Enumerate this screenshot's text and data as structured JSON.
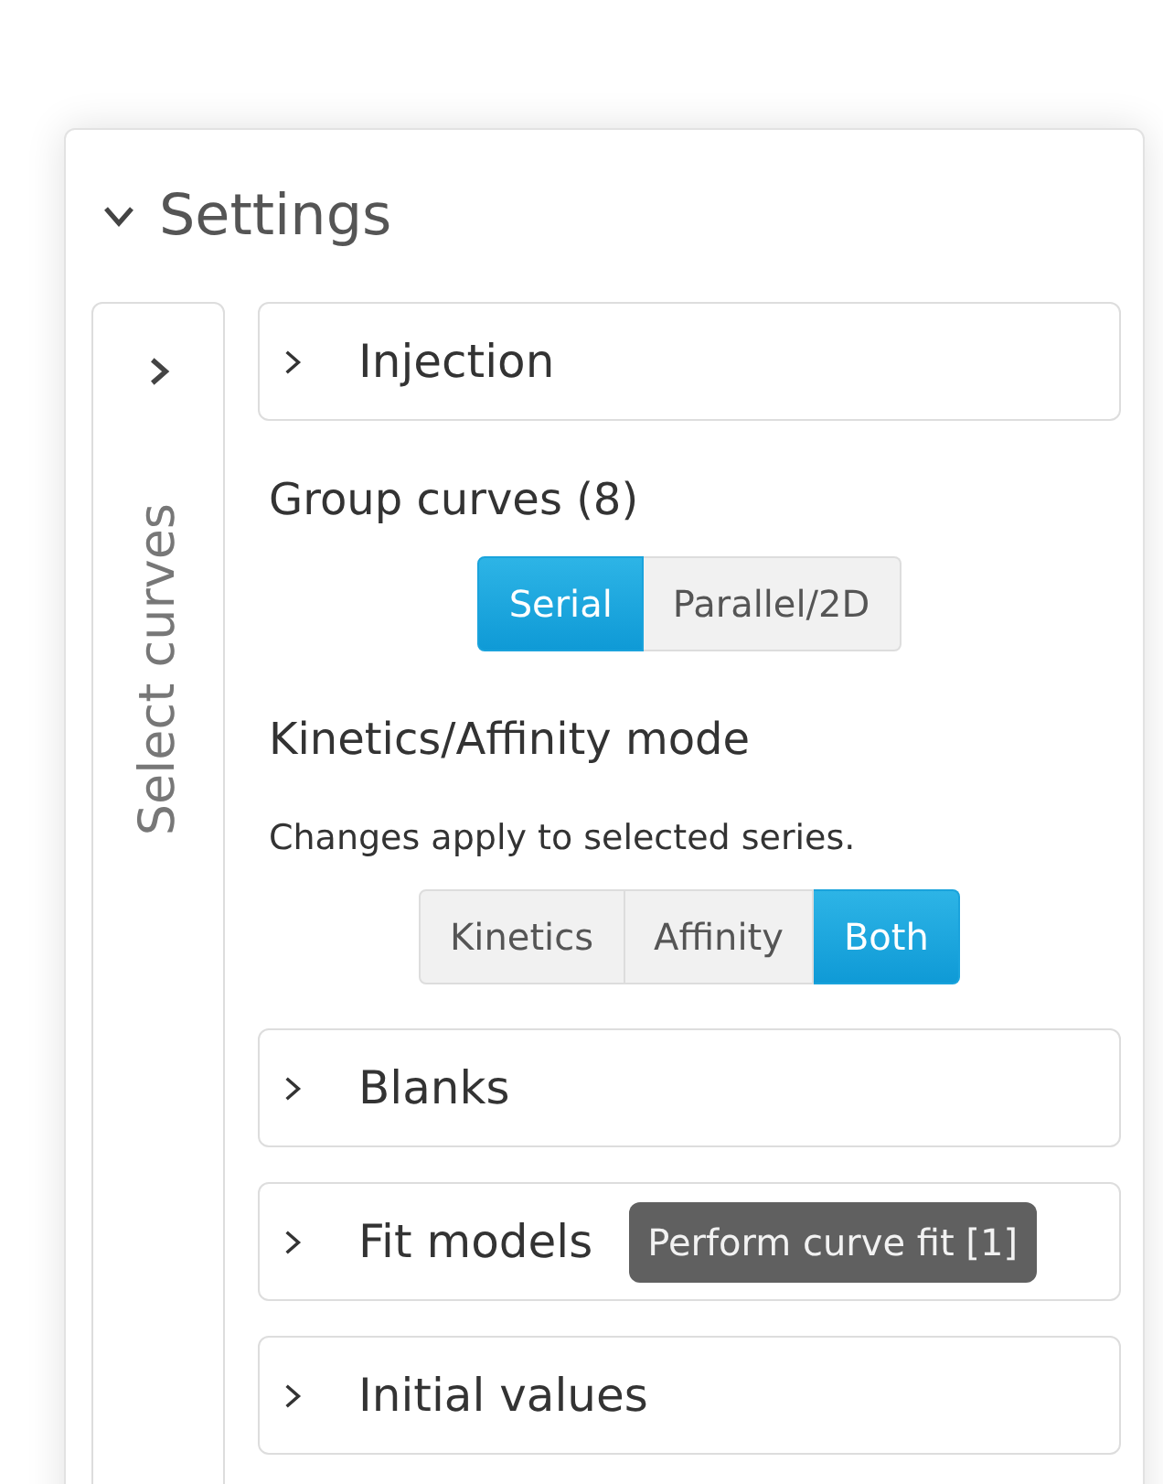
{
  "panel": {
    "title": "Settings",
    "expanded": true
  },
  "side_tab": {
    "label": "Select curves",
    "expanded": false
  },
  "items": [
    {
      "kind": "section",
      "title": "Injection",
      "expanded": false
    },
    {
      "kind": "label",
      "text": "Group curves (8)"
    },
    {
      "kind": "segmented",
      "options": [
        {
          "label": "Serial",
          "selected": true
        },
        {
          "label": "Parallel/2D",
          "selected": false
        }
      ]
    },
    {
      "kind": "label",
      "text": "Kinetics/Affinity mode"
    },
    {
      "kind": "note",
      "text": "Changes apply to selected series."
    },
    {
      "kind": "segmented",
      "options": [
        {
          "label": "Kinetics",
          "selected": false
        },
        {
          "label": "Affinity",
          "selected": false
        },
        {
          "label": "Both",
          "selected": true
        }
      ]
    },
    {
      "kind": "section",
      "title": "Blanks",
      "expanded": false
    },
    {
      "kind": "section",
      "title": "Fit models",
      "expanded": false,
      "action": "Perform curve fit [1]"
    },
    {
      "kind": "section",
      "title": "Initial values",
      "expanded": false
    }
  ]
}
